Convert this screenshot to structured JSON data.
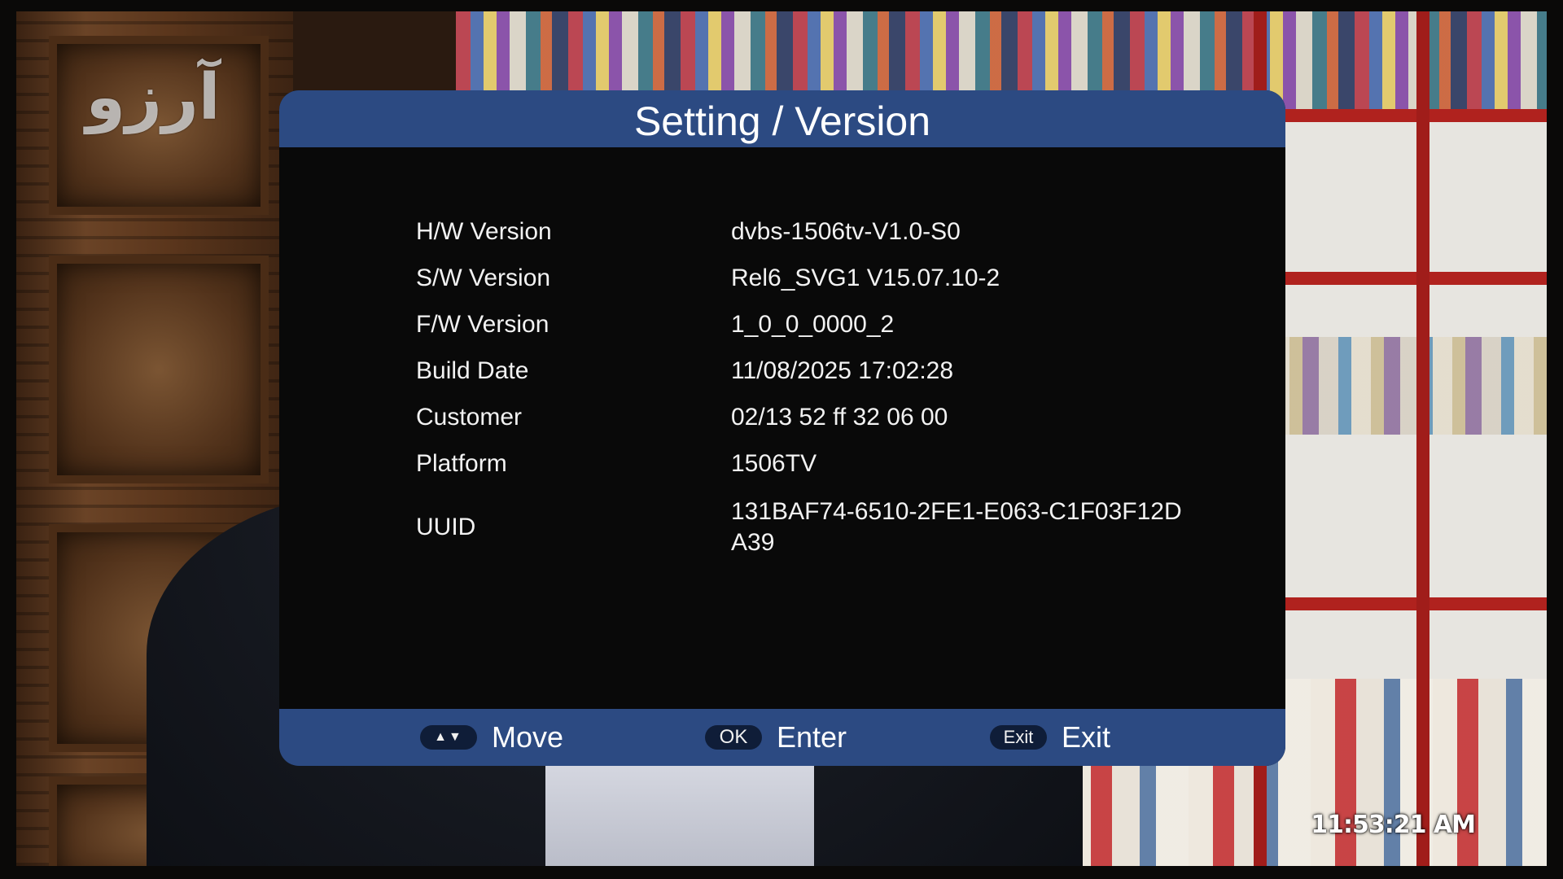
{
  "overlay": {
    "channel_logo": "آرزو",
    "clock": "11:53:21 AM"
  },
  "dialog": {
    "title": "Setting / Version",
    "rows": [
      {
        "label": "H/W Version",
        "value": "dvbs-1506tv-V1.0-S0"
      },
      {
        "label": "S/W Version",
        "value": "Rel6_SVG1 V15.07.10-2"
      },
      {
        "label": "F/W Version",
        "value": "1_0_0_0000_2"
      },
      {
        "label": "Build Date",
        "value": "11/08/2025 17:02:28"
      },
      {
        "label": "Customer",
        "value": "02/13 52 ff 32 06 00"
      },
      {
        "label": "Platform",
        "value": "1506TV"
      },
      {
        "label": "UUID",
        "value": "131BAF74-6510-2FE1-E063-C1F03F12D\nA39"
      }
    ],
    "footer": {
      "move": {
        "key": "▲▼",
        "label": "Move",
        "icon": "up-down-arrows-icon"
      },
      "enter": {
        "key": "OK",
        "label": "Enter"
      },
      "exit": {
        "key": "Exit",
        "label": "Exit"
      }
    }
  },
  "colors": {
    "header_footer_blue": "#2c4a82",
    "dialog_bg": "#090909",
    "key_cap_bg": "#0f1d38",
    "text": "#ffffff"
  }
}
